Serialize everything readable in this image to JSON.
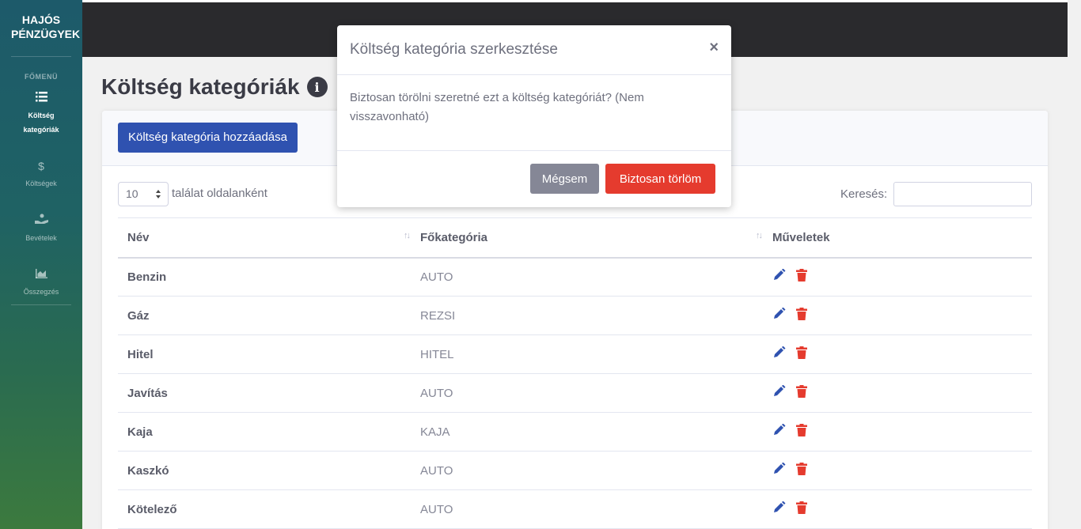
{
  "sidebar": {
    "brand": "HAJÓS PÉNZÜGYEK",
    "heading": "FŐMENÜ",
    "items": [
      {
        "label": "Költség kategóriák",
        "icon": "list-icon",
        "active": true
      },
      {
        "label": "Költségek",
        "icon": "dollar-icon",
        "active": false
      },
      {
        "label": "Bevételek",
        "icon": "hand-holding-dollar-icon",
        "active": false
      },
      {
        "label": "Összegzés",
        "icon": "chart-area-icon",
        "active": false
      }
    ]
  },
  "page": {
    "title": "Költség kategóriák",
    "add_button": "Költség kategória hozzáadása",
    "page_length_value": "10",
    "page_length_label": "találat oldalanként",
    "search_label": "Keresés:",
    "search_value": ""
  },
  "table": {
    "columns": [
      "Név",
      "Főkategória",
      "Műveletek"
    ],
    "rows": [
      {
        "name": "Benzin",
        "category": "AUTO"
      },
      {
        "name": "Gáz",
        "category": "REZSI"
      },
      {
        "name": "Hitel",
        "category": "HITEL"
      },
      {
        "name": "Javítás",
        "category": "AUTO"
      },
      {
        "name": "Kaja",
        "category": "KAJA"
      },
      {
        "name": "Kaszkó",
        "category": "AUTO"
      },
      {
        "name": "Kötelező",
        "category": "AUTO"
      }
    ]
  },
  "modal": {
    "title": "Költség kategória szerkesztése",
    "close": "×",
    "body": "Biztosan törölni szeretné ezt a költség kategóriát? (Nem visszavonható)",
    "cancel": "Mégsem",
    "confirm": "Biztosan törlöm"
  },
  "colors": {
    "primary": "#2f52b0",
    "danger": "#e53b2e",
    "secondary": "#858796",
    "topbar": "#2a2a2d",
    "edit_icon": "#2f52b0",
    "delete_icon": "#e53b2e"
  }
}
